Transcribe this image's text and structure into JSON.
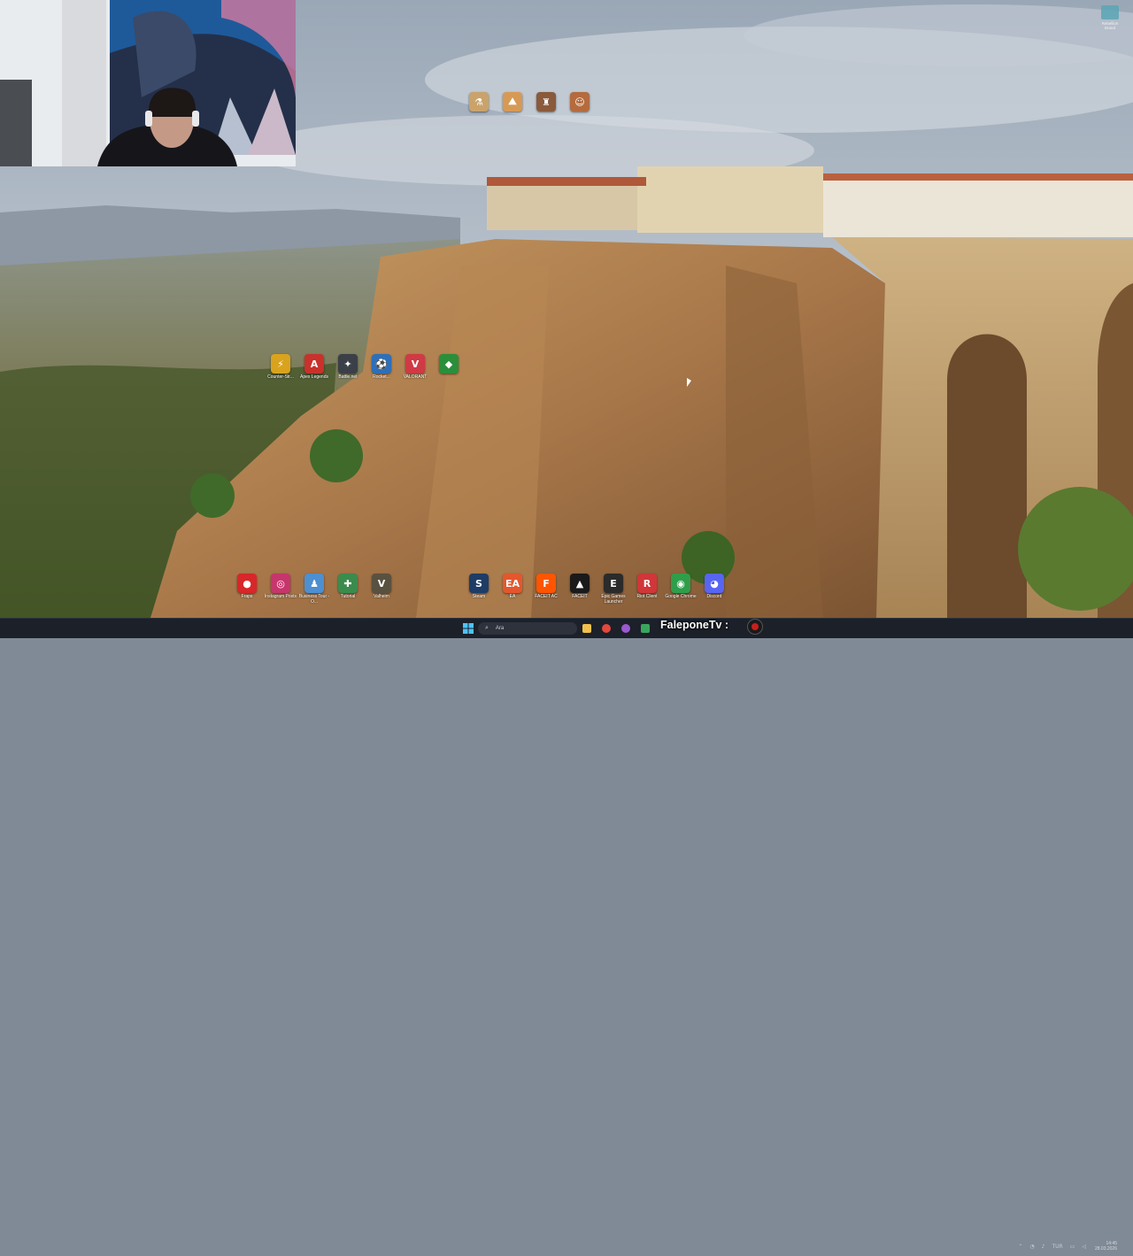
{
  "desktop": {
    "top_icons": [
      {
        "name": "app-icon-1",
        "label": "",
        "color": "#c9a36b",
        "glyph": "⚗"
      },
      {
        "name": "app-icon-2",
        "label": "",
        "color": "#d79a55",
        "glyph": "⛰"
      },
      {
        "name": "app-icon-3",
        "label": "",
        "color": "#8a5a3c",
        "glyph": "♜"
      },
      {
        "name": "app-icon-4",
        "label": "",
        "color": "#b56b3d",
        "glyph": "☺"
      }
    ],
    "middle_icons": [
      {
        "name": "counter-strike-icon",
        "label": "Counter-Str...",
        "color": "#d9a31d",
        "glyph": "⚡"
      },
      {
        "name": "apex-legends-icon",
        "label": "Apex Legends",
        "color": "#c8322b",
        "glyph": "A"
      },
      {
        "name": "battlenet-icon",
        "label": "Battle.net",
        "color": "#3a3f48",
        "glyph": "✦"
      },
      {
        "name": "rocket-league-icon",
        "label": "Rocket...",
        "color": "#2d6fb8",
        "glyph": "⚽"
      },
      {
        "name": "valorant-icon",
        "label": "VALORANT",
        "color": "#cf3a45",
        "glyph": "V"
      },
      {
        "name": "razer-icon",
        "label": "",
        "color": "#2a8f3a",
        "glyph": "◆"
      }
    ],
    "bottom_left_icons": [
      {
        "name": "fraps-icon",
        "label": "Fraps",
        "color": "#d8262a",
        "glyph": "●"
      },
      {
        "name": "instagram-icon",
        "label": "Instagram Posts",
        "color": "#c7356d",
        "glyph": "◎"
      },
      {
        "name": "business-tour-icon",
        "label": "Business Tour - O...",
        "color": "#4d8fd1",
        "glyph": "♟"
      },
      {
        "name": "tutorial-icon",
        "label": "Tutorial",
        "color": "#3b8b4d",
        "glyph": "✚"
      },
      {
        "name": "valhalla-icon",
        "label": "Valheim",
        "color": "#59513f",
        "glyph": "V"
      }
    ],
    "bottom_right_icons": [
      {
        "name": "steam-icon",
        "label": "Steam",
        "color": "#1d3c66",
        "glyph": "S"
      },
      {
        "name": "ea-icon",
        "label": "EA",
        "color": "#e4572e",
        "glyph": "EA"
      },
      {
        "name": "faceit-ac-icon",
        "label": "FACEIT AC",
        "color": "#ff5500",
        "glyph": "F"
      },
      {
        "name": "faceit-icon",
        "label": "FACEIT",
        "color": "#1a1a1a",
        "glyph": "▲"
      },
      {
        "name": "epic-games-icon",
        "label": "Epic Games Launcher",
        "color": "#2b2b2b",
        "glyph": "E"
      },
      {
        "name": "riot-client-icon",
        "label": "Riot Client",
        "color": "#d13639",
        "glyph": "R"
      },
      {
        "name": "google-chrome-icon",
        "label": "Google Chrome",
        "color": "#2f9e4a",
        "glyph": "◉"
      },
      {
        "name": "discord-icon",
        "label": "Discord",
        "color": "#5865f2",
        "glyph": "◕"
      }
    ]
  },
  "top_right_widget": {
    "label": "Rebellion Brand"
  },
  "taskbar": {
    "search_placeholder": "Ara",
    "apps": [
      {
        "name": "file-explorer-taskbar-icon",
        "color": "#f2c04b"
      },
      {
        "name": "chrome-taskbar-icon",
        "color": "#e2483b"
      },
      {
        "name": "browser-taskbar-icon",
        "color": "#9b59d0"
      },
      {
        "name": "store-taskbar-icon",
        "color": "#3aa55d"
      }
    ],
    "overlay_text": "FaleponeTv :",
    "tray": {
      "lang": "TUR",
      "time": "14:45",
      "date": "28.03.2026"
    }
  }
}
